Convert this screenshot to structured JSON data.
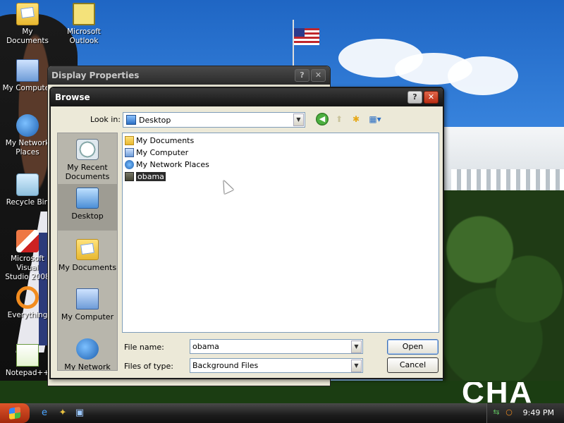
{
  "desktop": {
    "icons": [
      {
        "label": "My Documents",
        "icon": "my-documents-icon"
      },
      {
        "label": "Microsoft\nOutlook",
        "icon": "outlook-icon"
      },
      {
        "label": "My Computer",
        "icon": "my-computer-icon"
      },
      {
        "label": "My Network\nPlaces",
        "icon": "network-places-icon"
      },
      {
        "label": "Recycle Bin",
        "icon": "recycle-bin-icon"
      },
      {
        "label": "Microsoft Visual\nStudio 2008",
        "icon": "visual-studio-icon"
      },
      {
        "label": "Everything",
        "icon": "everything-icon"
      },
      {
        "label": "Notepad++",
        "icon": "notepad-plus-plus-icon"
      }
    ],
    "wallpaper_text": "CHA"
  },
  "display_properties": {
    "title": "Display Properties",
    "help_btn": "?",
    "close_btn": "✕"
  },
  "browse": {
    "title": "Browse",
    "help_btn": "?",
    "close_btn": "✕",
    "look_in_label": "Look in:",
    "look_in_value": "Desktop",
    "places": [
      {
        "label": "My Recent\nDocuments",
        "icon": "recent-documents-icon"
      },
      {
        "label": "Desktop",
        "icon": "desktop-icon",
        "selected": true
      },
      {
        "label": "My Documents",
        "icon": "my-documents-icon"
      },
      {
        "label": "My Computer",
        "icon": "my-computer-icon"
      },
      {
        "label": "My Network",
        "icon": "network-places-icon"
      }
    ],
    "files": [
      {
        "label": "My Documents",
        "icon": "folder-icon"
      },
      {
        "label": "My Computer",
        "icon": "computer-icon"
      },
      {
        "label": "My Network Places",
        "icon": "network-icon"
      },
      {
        "label": "obama",
        "icon": "image-file-icon",
        "selected": true
      }
    ],
    "file_name_label": "File name:",
    "file_name_value": "obama",
    "file_type_label": "Files of type:",
    "file_type_value": "Background Files",
    "open_button": "Open",
    "cancel_button": "Cancel"
  },
  "taskbar": {
    "clock": "9:49 PM"
  },
  "colors": {
    "dialog_face": "#ece9d8",
    "title_dark": "#1a1a1a",
    "selection_dark": "#2b2b2b",
    "default_button_border": "#3c6eb4"
  }
}
